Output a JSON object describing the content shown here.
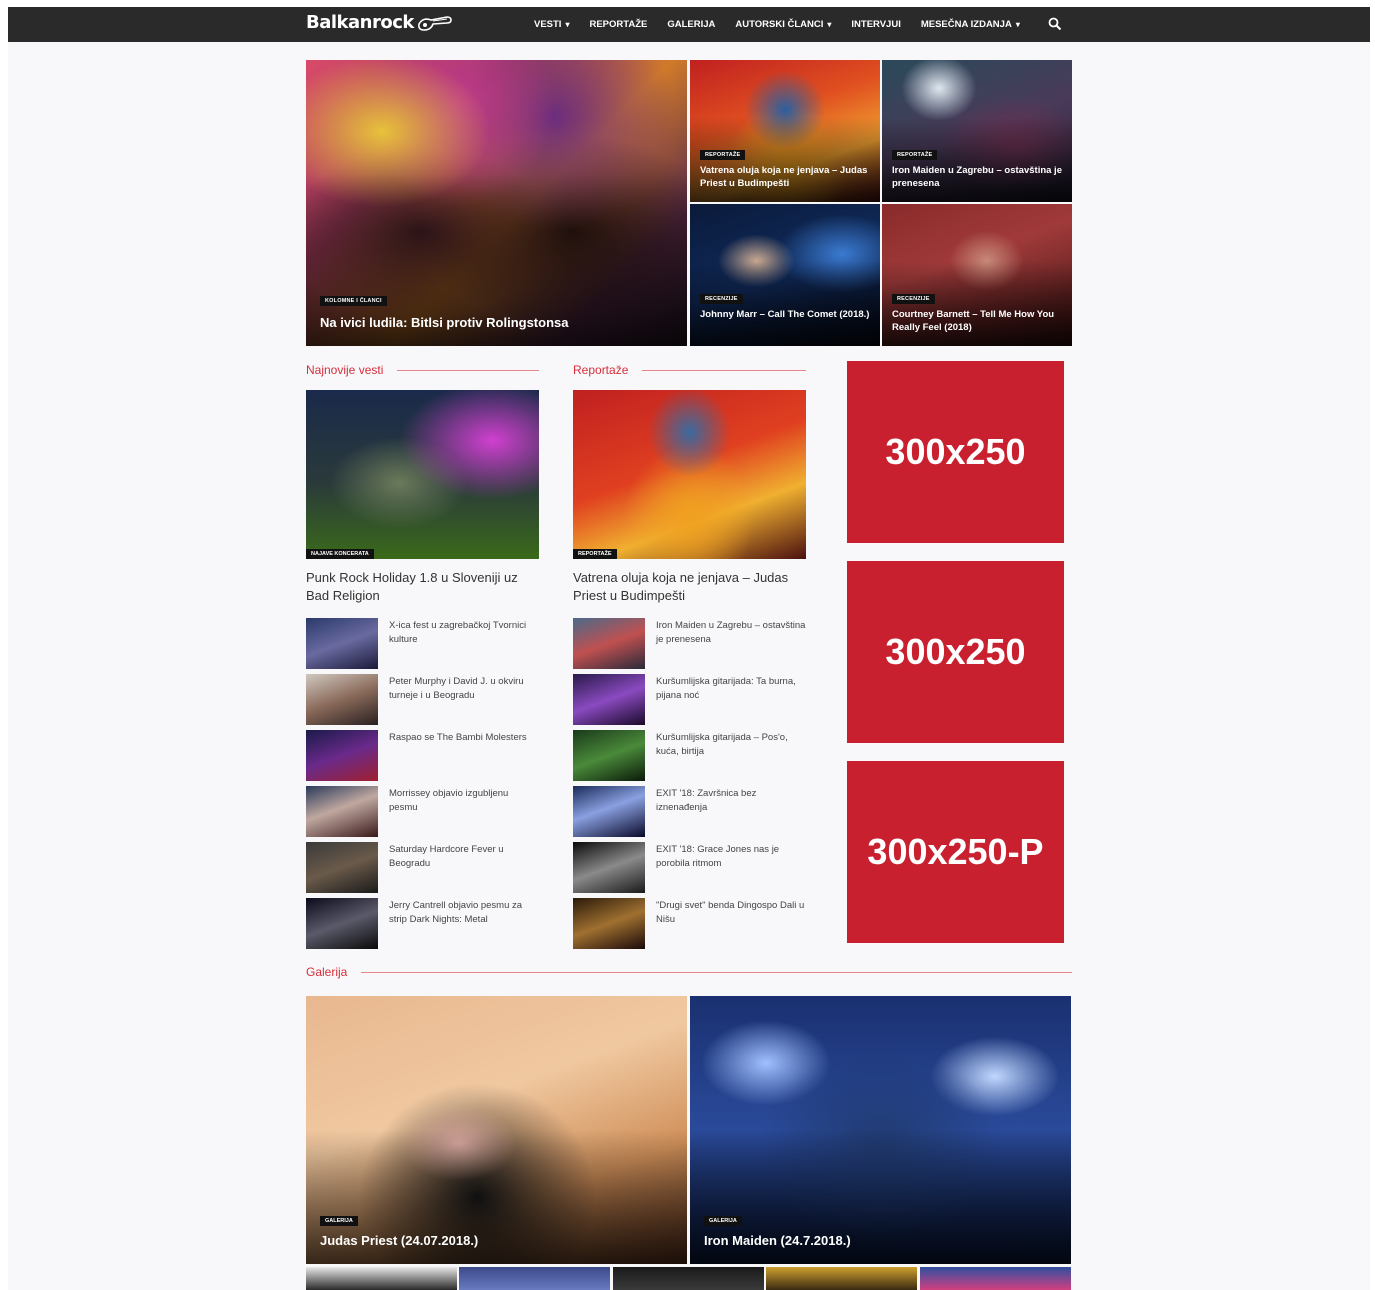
{
  "brand": {
    "name": "Balkanrock",
    "accent": "#d62e3a",
    "ad_color": "#c8202f",
    "nav_bg": "#2a2a2a"
  },
  "nav": {
    "items": [
      {
        "label": "VESTI",
        "has_dropdown": true
      },
      {
        "label": "REPORTAŽE",
        "has_dropdown": false
      },
      {
        "label": "GALERIJA",
        "has_dropdown": false
      },
      {
        "label": "AUTORSKI ČLANCI",
        "has_dropdown": true
      },
      {
        "label": "INTERVJUI",
        "has_dropdown": false
      },
      {
        "label": "MESEČNA IZDANJA",
        "has_dropdown": true
      }
    ],
    "dropdown_icon": "chevron-down-icon",
    "search_icon": "search-icon"
  },
  "hero": {
    "main": {
      "category": "KOLOMNE I ČLANCI",
      "title": "Na ivici ludila: Bitlsi protiv Rolingstonsa"
    },
    "tiles": [
      {
        "category": "REPORTAŽE",
        "title": "Vatrena oluja koja ne jenjava – Judas Priest u Budimpešti"
      },
      {
        "category": "REPORTAŽE",
        "title": "Iron Maiden u Zagrebu – ostavština je prenesena"
      },
      {
        "category": "RECENZIJE",
        "title": "Johnny Marr – Call The Comet (2018.)"
      },
      {
        "category": "RECENZIJE",
        "title": "Courtney Barnett – Tell Me How You Really Feel (2018)"
      }
    ]
  },
  "latest": {
    "heading": "Najnovije vesti",
    "featured": {
      "category": "NAJAVE KONCERATA",
      "title": "Punk Rock Holiday 1.8 u Sloveniji uz Bad Religion"
    },
    "items": [
      "X-ica fest u zagrebačkoj Tvornici kulture",
      "Peter Murphy i David J. u okviru turneje i u Beogradu",
      "Raspao se The Bambi Molesters",
      "Morrissey objavio izgubljenu pesmu",
      "Saturday Hardcore Fever u Beogradu",
      "Jerry Cantrell objavio pesmu za strip Dark Nights: Metal"
    ]
  },
  "reports": {
    "heading": "Reportaže",
    "featured": {
      "category": "REPORTAŽE",
      "title": "Vatrena oluja koja ne jenjava – Judas Priest u Budimpešti"
    },
    "items": [
      "Iron Maiden u Zagrebu – ostavština je prenesena",
      "Kuršumlijska gitarijada: Ta burna, pijana noć",
      "Kuršumlijska gitarijada – Pos'o, kuća, birtija",
      "EXIT '18: Završnica bez iznenađenja",
      "EXIT '18: Grace Jones nas je porobila ritmom",
      "\"Drugi svet\" benda Dingospo Dali u Nišu"
    ]
  },
  "ads": [
    "300x250",
    "300x250",
    "300x250-P"
  ],
  "gallery": {
    "heading": "Galerija",
    "tiles": [
      {
        "category": "GALERIJA",
        "title": "Judas Priest (24.07.2018.)"
      },
      {
        "category": "GALERIJA",
        "title": "Iron Maiden (24.7.2018.)"
      }
    ]
  }
}
